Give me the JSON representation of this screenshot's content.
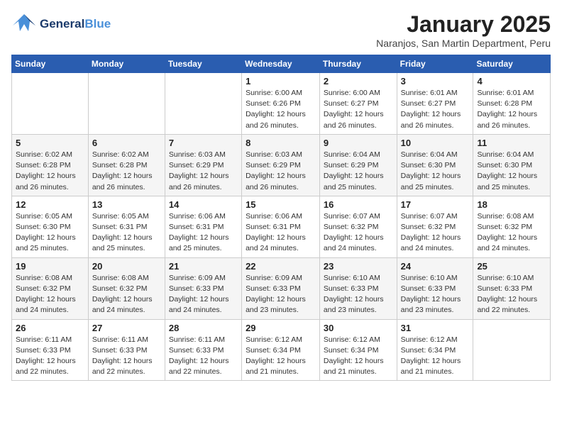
{
  "header": {
    "logo_general": "General",
    "logo_blue": "Blue",
    "month_year": "January 2025",
    "location": "Naranjos, San Martin Department, Peru"
  },
  "days_of_week": [
    "Sunday",
    "Monday",
    "Tuesday",
    "Wednesday",
    "Thursday",
    "Friday",
    "Saturday"
  ],
  "weeks": [
    [
      {
        "day": "",
        "info": ""
      },
      {
        "day": "",
        "info": ""
      },
      {
        "day": "",
        "info": ""
      },
      {
        "day": "1",
        "info": "Sunrise: 6:00 AM\nSunset: 6:26 PM\nDaylight: 12 hours\nand 26 minutes."
      },
      {
        "day": "2",
        "info": "Sunrise: 6:00 AM\nSunset: 6:27 PM\nDaylight: 12 hours\nand 26 minutes."
      },
      {
        "day": "3",
        "info": "Sunrise: 6:01 AM\nSunset: 6:27 PM\nDaylight: 12 hours\nand 26 minutes."
      },
      {
        "day": "4",
        "info": "Sunrise: 6:01 AM\nSunset: 6:28 PM\nDaylight: 12 hours\nand 26 minutes."
      }
    ],
    [
      {
        "day": "5",
        "info": "Sunrise: 6:02 AM\nSunset: 6:28 PM\nDaylight: 12 hours\nand 26 minutes."
      },
      {
        "day": "6",
        "info": "Sunrise: 6:02 AM\nSunset: 6:28 PM\nDaylight: 12 hours\nand 26 minutes."
      },
      {
        "day": "7",
        "info": "Sunrise: 6:03 AM\nSunset: 6:29 PM\nDaylight: 12 hours\nand 26 minutes."
      },
      {
        "day": "8",
        "info": "Sunrise: 6:03 AM\nSunset: 6:29 PM\nDaylight: 12 hours\nand 26 minutes."
      },
      {
        "day": "9",
        "info": "Sunrise: 6:04 AM\nSunset: 6:29 PM\nDaylight: 12 hours\nand 25 minutes."
      },
      {
        "day": "10",
        "info": "Sunrise: 6:04 AM\nSunset: 6:30 PM\nDaylight: 12 hours\nand 25 minutes."
      },
      {
        "day": "11",
        "info": "Sunrise: 6:04 AM\nSunset: 6:30 PM\nDaylight: 12 hours\nand 25 minutes."
      }
    ],
    [
      {
        "day": "12",
        "info": "Sunrise: 6:05 AM\nSunset: 6:30 PM\nDaylight: 12 hours\nand 25 minutes."
      },
      {
        "day": "13",
        "info": "Sunrise: 6:05 AM\nSunset: 6:31 PM\nDaylight: 12 hours\nand 25 minutes."
      },
      {
        "day": "14",
        "info": "Sunrise: 6:06 AM\nSunset: 6:31 PM\nDaylight: 12 hours\nand 25 minutes."
      },
      {
        "day": "15",
        "info": "Sunrise: 6:06 AM\nSunset: 6:31 PM\nDaylight: 12 hours\nand 24 minutes."
      },
      {
        "day": "16",
        "info": "Sunrise: 6:07 AM\nSunset: 6:32 PM\nDaylight: 12 hours\nand 24 minutes."
      },
      {
        "day": "17",
        "info": "Sunrise: 6:07 AM\nSunset: 6:32 PM\nDaylight: 12 hours\nand 24 minutes."
      },
      {
        "day": "18",
        "info": "Sunrise: 6:08 AM\nSunset: 6:32 PM\nDaylight: 12 hours\nand 24 minutes."
      }
    ],
    [
      {
        "day": "19",
        "info": "Sunrise: 6:08 AM\nSunset: 6:32 PM\nDaylight: 12 hours\nand 24 minutes."
      },
      {
        "day": "20",
        "info": "Sunrise: 6:08 AM\nSunset: 6:32 PM\nDaylight: 12 hours\nand 24 minutes."
      },
      {
        "day": "21",
        "info": "Sunrise: 6:09 AM\nSunset: 6:33 PM\nDaylight: 12 hours\nand 24 minutes."
      },
      {
        "day": "22",
        "info": "Sunrise: 6:09 AM\nSunset: 6:33 PM\nDaylight: 12 hours\nand 23 minutes."
      },
      {
        "day": "23",
        "info": "Sunrise: 6:10 AM\nSunset: 6:33 PM\nDaylight: 12 hours\nand 23 minutes."
      },
      {
        "day": "24",
        "info": "Sunrise: 6:10 AM\nSunset: 6:33 PM\nDaylight: 12 hours\nand 23 minutes."
      },
      {
        "day": "25",
        "info": "Sunrise: 6:10 AM\nSunset: 6:33 PM\nDaylight: 12 hours\nand 22 minutes."
      }
    ],
    [
      {
        "day": "26",
        "info": "Sunrise: 6:11 AM\nSunset: 6:33 PM\nDaylight: 12 hours\nand 22 minutes."
      },
      {
        "day": "27",
        "info": "Sunrise: 6:11 AM\nSunset: 6:33 PM\nDaylight: 12 hours\nand 22 minutes."
      },
      {
        "day": "28",
        "info": "Sunrise: 6:11 AM\nSunset: 6:33 PM\nDaylight: 12 hours\nand 22 minutes."
      },
      {
        "day": "29",
        "info": "Sunrise: 6:12 AM\nSunset: 6:34 PM\nDaylight: 12 hours\nand 21 minutes."
      },
      {
        "day": "30",
        "info": "Sunrise: 6:12 AM\nSunset: 6:34 PM\nDaylight: 12 hours\nand 21 minutes."
      },
      {
        "day": "31",
        "info": "Sunrise: 6:12 AM\nSunset: 6:34 PM\nDaylight: 12 hours\nand 21 minutes."
      },
      {
        "day": "",
        "info": ""
      }
    ]
  ]
}
